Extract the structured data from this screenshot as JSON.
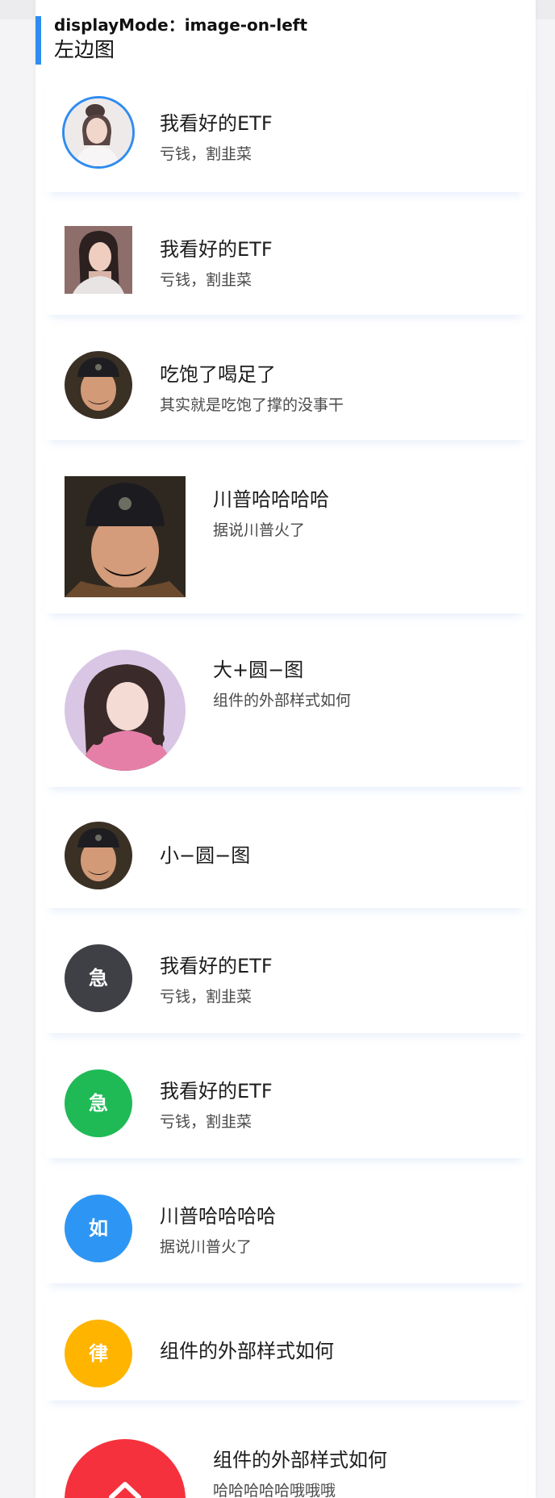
{
  "section": {
    "mode_label": "displayMode：image-on-left",
    "title": "左边图"
  },
  "items": [
    {
      "title": "我看好的ETF",
      "subtitle": "亏钱，割韭菜",
      "image": "woman-portrait-circle-bordered"
    },
    {
      "title": "我看好的ETF",
      "subtitle": "亏钱，割韭菜",
      "image": "woman-portrait-square"
    },
    {
      "title": "吃饱了喝足了",
      "subtitle": "其实就是吃饱了撑的没事干",
      "image": "man-portrait-circle"
    },
    {
      "title": "川普哈哈哈哈",
      "subtitle": "据说川普火了",
      "image": "man-portrait-large-square"
    },
    {
      "title": "大+圆−图",
      "subtitle": "组件的外部样式如何",
      "image": "woman-portrait-large-circle"
    },
    {
      "title": "小−圆−图",
      "image": "man-portrait-small-circle"
    },
    {
      "title": "我看好的ETF",
      "subtitle": "亏钱，割韭菜",
      "avatar_text": "急",
      "avatar_color": "#3f4046"
    },
    {
      "title": "我看好的ETF",
      "subtitle": "亏钱，割韭菜",
      "avatar_text": "急",
      "avatar_color": "#1fba55"
    },
    {
      "title": "川普哈哈哈哈",
      "subtitle": "据说川普火了",
      "avatar_text": "如",
      "avatar_color": "#2d96f4"
    },
    {
      "title": "组件的外部样式如何",
      "avatar_text": "律",
      "avatar_color": "#ffb400"
    },
    {
      "title": "组件的外部样式如何",
      "subtitle": "哈哈哈哈哈哦哦哦",
      "avatar_color": "#f5313d",
      "avatar_icon": "home-icon"
    }
  ],
  "colors": {
    "accent": "#2f8cf0",
    "card_shadow": "#eaf2fd"
  }
}
